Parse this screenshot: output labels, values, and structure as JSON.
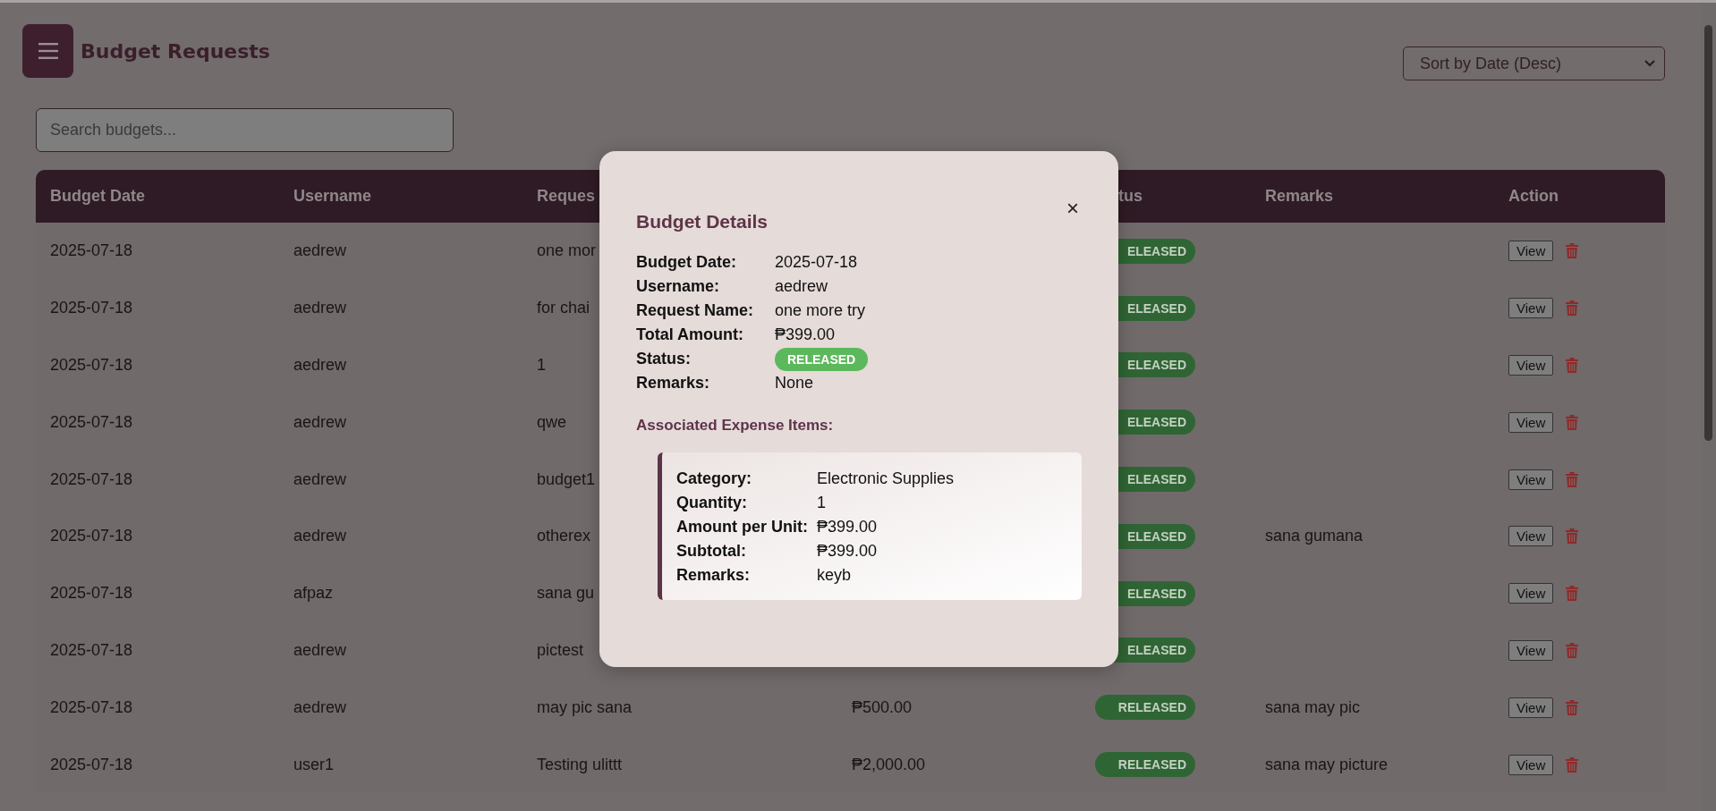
{
  "header": {
    "title": "Budget Requests"
  },
  "sort_select": {
    "value": "Sort by Date (Desc)"
  },
  "search": {
    "placeholder": "Search budgets..."
  },
  "table": {
    "columns": [
      {
        "label": "Budget Date"
      },
      {
        "label": "Username"
      },
      {
        "label": "Reques"
      },
      {},
      {
        "label": "tus"
      },
      {
        "label": "Remarks"
      },
      {
        "label": "Action"
      }
    ],
    "rows": [
      {
        "date": "2025-07-18",
        "username": "aedrew",
        "request": "one mor",
        "status": {
          "label": "ELEASED",
          "color": "#2f6534"
        },
        "action": "View"
      },
      {
        "date": "2025-07-18",
        "username": "aedrew",
        "request": "for chai",
        "status": {
          "label": "ELEASED",
          "color": "#2f6534"
        },
        "action": "View"
      },
      {
        "date": "2025-07-18",
        "username": "aedrew",
        "request": "1",
        "status": {
          "label": "ELEASED",
          "color": "#2f6534"
        },
        "action": "View"
      },
      {
        "date": "2025-07-18",
        "username": "aedrew",
        "request": "qwe",
        "status": {
          "label": "ELEASED",
          "color": "#2f6534"
        },
        "action": "View"
      },
      {
        "date": "2025-07-18",
        "username": "aedrew",
        "request": "budget1",
        "status": {
          "label": "ELEASED",
          "color": "#2f6534"
        },
        "action": "View"
      },
      {
        "date": "2025-07-18",
        "username": "aedrew",
        "request": "otherex",
        "status": {
          "label": "ELEASED",
          "color": "#2f6534"
        },
        "remarks": "sana gumana",
        "action": "View"
      },
      {
        "date": "2025-07-18",
        "username": "afpaz",
        "request": "sana gu",
        "status": {
          "label": "ELEASED",
          "color": "#2f6534"
        },
        "action": "View"
      },
      {
        "date": "2025-07-18",
        "username": "aedrew",
        "request": "pictest",
        "status": {
          "label": "ELEASED",
          "color": "#2f6534"
        },
        "action": "View"
      },
      {
        "date": "2025-07-18",
        "username": "aedrew",
        "request": "may pic sana",
        "amount": "₱500.00",
        "status": {
          "label": "RELEASED",
          "color": "#2f6534"
        },
        "remarks": "sana may pic",
        "action": "View"
      },
      {
        "date": "2025-07-18",
        "username": "user1",
        "request": "Testing ulittt",
        "amount": "₱2,000.00",
        "status": {
          "label": "RELEASED",
          "color": "#2f6534"
        },
        "remarks": "sana may picture",
        "action": "View"
      }
    ]
  },
  "modal": {
    "title": "Budget Details",
    "close": "×",
    "fields": [
      {
        "label": "Budget Date:",
        "value": "2025-07-18",
        "kind": "text"
      },
      {
        "label": "Username:",
        "value": "aedrew",
        "kind": "text"
      },
      {
        "label": "Request Name:",
        "value": "one more try",
        "kind": "text"
      },
      {
        "label": "Total Amount:",
        "value": "₱399.00",
        "kind": "text"
      },
      {
        "label": "Status:",
        "value": "RELEASED",
        "kind": "badge"
      },
      {
        "label": "Remarks:",
        "value": "None",
        "kind": "text"
      }
    ],
    "items_heading": "Associated Expense Items:",
    "items": [
      {
        "fields": [
          {
            "label": "Category:",
            "value": "Electronic Supplies"
          },
          {
            "label": "Quantity:",
            "value": "1"
          },
          {
            "label": "Amount per Unit:",
            "value": "₱399.00"
          },
          {
            "label": "Subtotal:",
            "value": "₱399.00"
          },
          {
            "label": "Remarks:",
            "value": "keyb"
          }
        ]
      }
    ]
  }
}
